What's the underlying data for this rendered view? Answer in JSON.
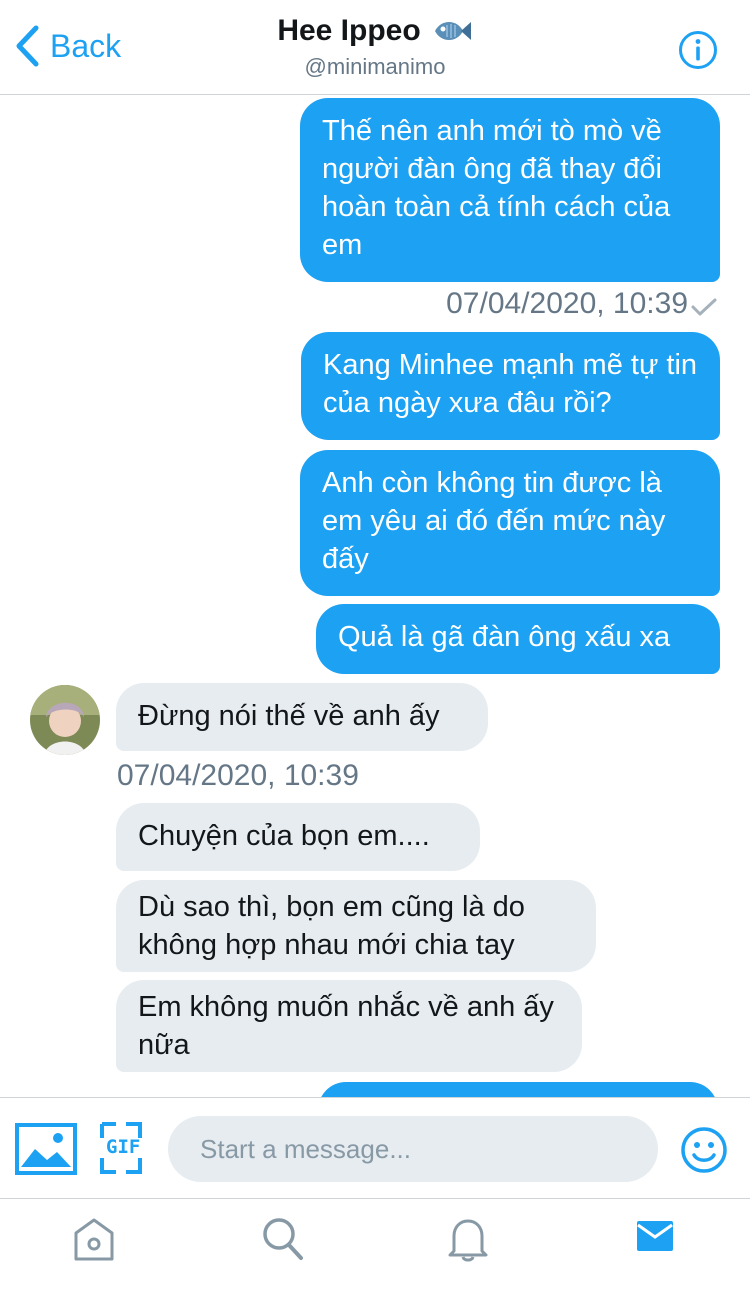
{
  "header": {
    "back_label": "Back",
    "name": "Hee Ippeo",
    "name_emoji": "fish-emoji",
    "handle": "@minimanimo"
  },
  "messages": [
    {
      "dir": "out",
      "text": "Thế nên anh mới tò mò về người đàn ông đã thay đổi hoàn toàn cả tính cách của em"
    },
    {
      "dir": "out",
      "text": "Kang Minhee mạnh mẽ tự tin của ngày xưa đâu rồi?"
    },
    {
      "dir": "out",
      "text": "Anh còn không tin được là em yêu ai đó đến mức này đấy"
    },
    {
      "dir": "out",
      "text": "Quả là gã đàn ông xấu xa"
    },
    {
      "dir": "in",
      "text": "Đừng nói thế về anh ấy"
    },
    {
      "dir": "in",
      "text": "Chuyện của bọn em...."
    },
    {
      "dir": "in",
      "text": "Dù sao thì, bọn em cũng là do không hợp nhau mới chia tay"
    },
    {
      "dir": "in",
      "text": "Em không muốn nhắc về anh ấy nữa"
    }
  ],
  "timestamps": {
    "sent": "07/04/2020, 10:39",
    "received": "07/04/2020, 10:39"
  },
  "composer": {
    "placeholder": "Start a message...",
    "gif_label": "GIF"
  },
  "colors": {
    "accent": "#1da1f2",
    "incoming_bubble": "#e6ecf0",
    "muted_text": "#657786",
    "tab_inactive": "#8899a6"
  },
  "tabs": [
    {
      "icon": "home-icon",
      "active": false
    },
    {
      "icon": "search-icon",
      "active": false
    },
    {
      "icon": "bell-icon",
      "active": false
    },
    {
      "icon": "mail-icon",
      "active": true
    }
  ]
}
